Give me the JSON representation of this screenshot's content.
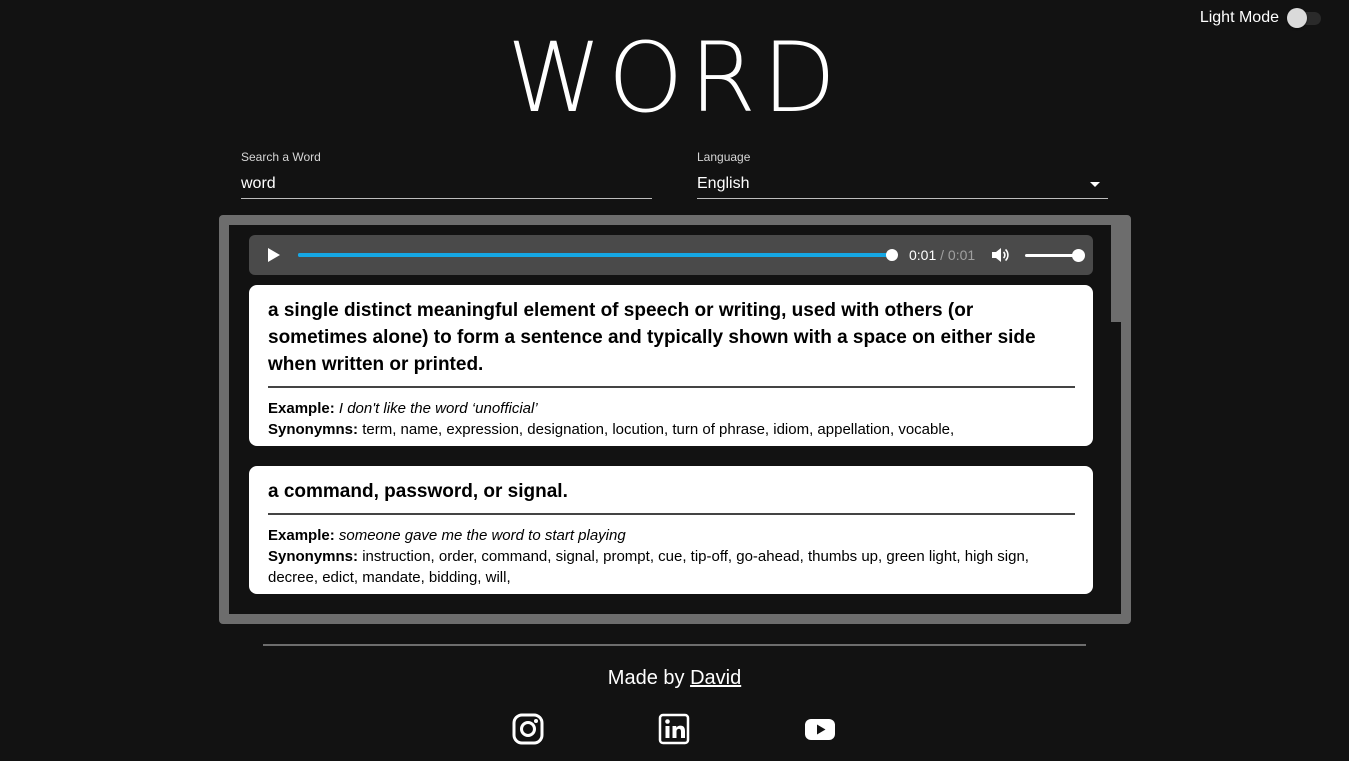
{
  "theme": {
    "label": "Light Mode",
    "on": false
  },
  "logo": {
    "text": "WORD"
  },
  "search": {
    "label": "Search a Word",
    "value": "word"
  },
  "language": {
    "label": "Language",
    "value": "English"
  },
  "audio": {
    "current": "0:01",
    "separator": " / ",
    "duration": "0:01",
    "progress": 1.0,
    "volume": 1.0
  },
  "definitions": [
    {
      "text": "a single distinct meaningful element of speech or writing, used with others (or sometimes alone) to form a sentence and typically shown with a space on either side when written or printed.",
      "example_label": "Example:",
      "example": "I don't like the word ‘unofficial’",
      "synonyms_label": "Synonymns:",
      "synonyms": "term, name, expression, designation, locution, turn of phrase, idiom, appellation, vocable,"
    },
    {
      "text": "a command, password, or signal.",
      "example_label": "Example:",
      "example": "someone gave me the word to start playing",
      "synonyms_label": "Synonymns:",
      "synonyms": "instruction, order, command, signal, prompt, cue, tip-off, go-ahead, thumbs up, green light, high sign, decree, edict, mandate, bidding, will,"
    }
  ],
  "footer": {
    "made_by": "Made by",
    "author": "David"
  },
  "social": [
    "instagram-icon",
    "linkedin-icon",
    "youtube-icon"
  ],
  "colors": {
    "background": "#121212",
    "frame": "#6d6d6d",
    "accent": "#15a7e4",
    "card": "#ffffff"
  }
}
